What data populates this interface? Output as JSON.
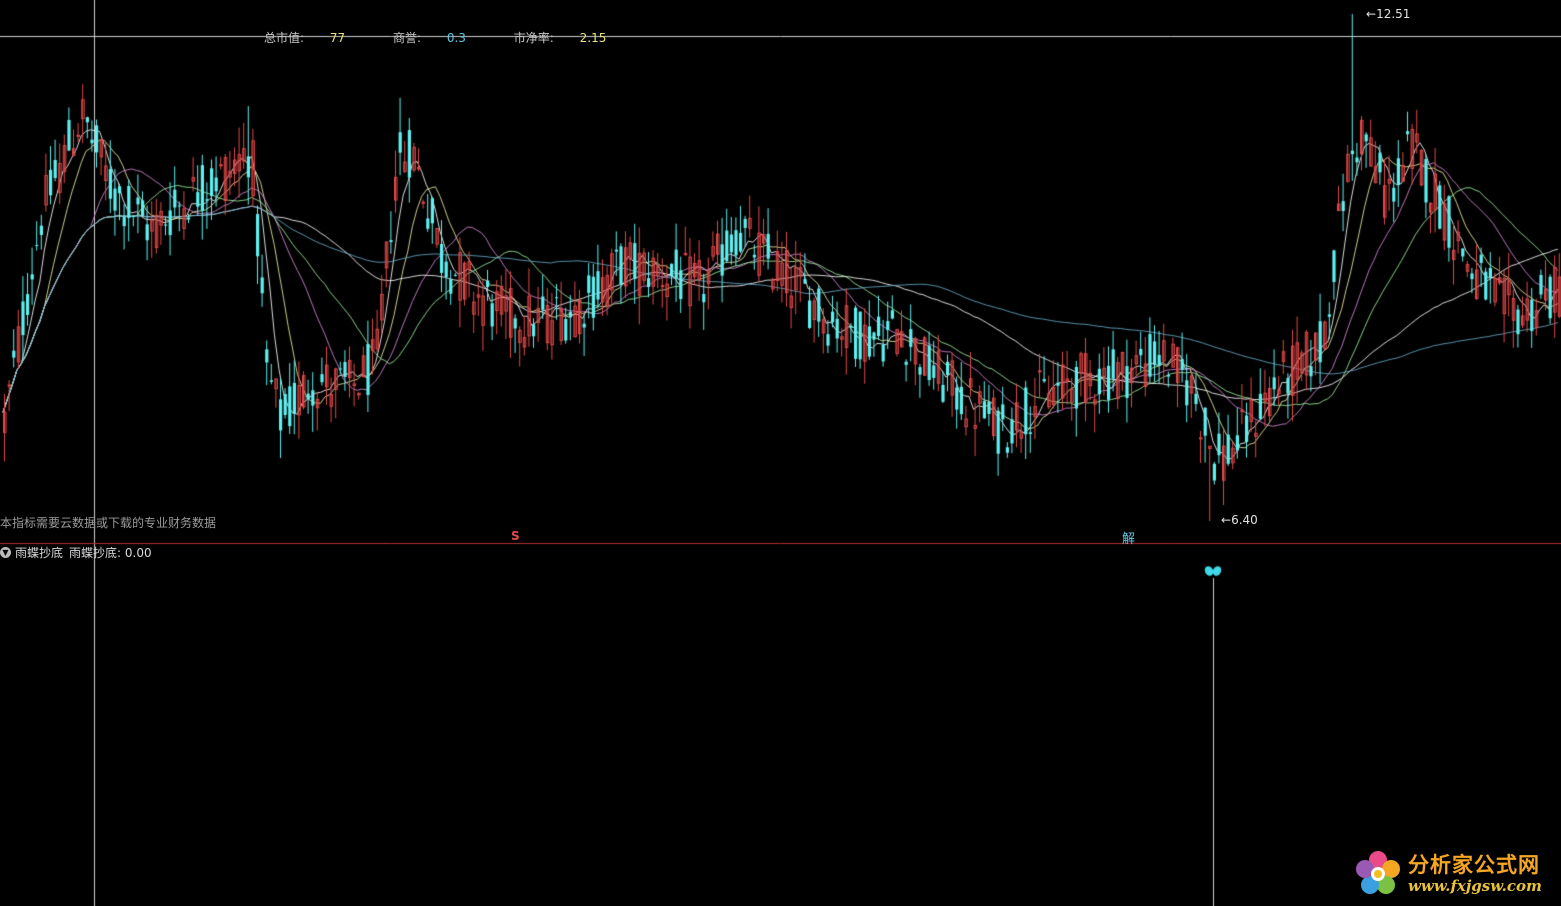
{
  "info_bar": {
    "mkt_cap_label": "总市值:",
    "mkt_cap_value": "77",
    "goodwill_label": "商誉:",
    "goodwill_value": "0.3",
    "pb_label": "市净率:",
    "pb_value": "2.15"
  },
  "note": "本指标需要云数据或下载的专业财务数据",
  "markers": {
    "s": "S",
    "jie": "解"
  },
  "sub_panel": {
    "indicator_name": "雨蝶抄底",
    "indicator_value_label": "雨蝶抄底: 0.00"
  },
  "price_labels": {
    "high": "12.51",
    "low": "6.40"
  },
  "logo": {
    "cn": "分析家公式网",
    "en": "www.fxjgsw.com"
  },
  "colors": {
    "background": "#000000",
    "up": "#e04848",
    "down": "#5ff0f0",
    "divider": "#b03030",
    "grid": "#cfcfcf",
    "ma_lines": [
      "#ffffff",
      "#f0f0a0",
      "#d88ad8",
      "#a0f0a0",
      "#ffffff",
      "#6aaac8"
    ]
  },
  "chart_data": {
    "type": "candlestick",
    "y_high": 12.51,
    "y_low": 6.4,
    "anchors_close": [
      [
        0,
        7.4
      ],
      [
        40,
        10.1
      ],
      [
        80,
        11.3
      ],
      [
        110,
        10.4
      ],
      [
        150,
        9.9
      ],
      [
        185,
        10.3
      ],
      [
        225,
        10.6
      ],
      [
        250,
        10.9
      ],
      [
        265,
        8.2
      ],
      [
        280,
        7.6
      ],
      [
        310,
        8.1
      ],
      [
        350,
        8.0
      ],
      [
        375,
        8.3
      ],
      [
        395,
        10.7
      ],
      [
        410,
        10.9
      ],
      [
        440,
        9.6
      ],
      [
        470,
        9.2
      ],
      [
        500,
        8.9
      ],
      [
        540,
        8.8
      ],
      [
        580,
        9.0
      ],
      [
        620,
        9.5
      ],
      [
        660,
        9.4
      ],
      [
        700,
        9.2
      ],
      [
        735,
        9.9
      ],
      [
        760,
        9.6
      ],
      [
        790,
        9.3
      ],
      [
        830,
        8.8
      ],
      [
        870,
        8.6
      ],
      [
        900,
        8.7
      ],
      [
        930,
        8.2
      ],
      [
        960,
        7.9
      ],
      [
        1000,
        7.5
      ],
      [
        1040,
        7.9
      ],
      [
        1080,
        8.1
      ],
      [
        1120,
        8.2
      ],
      [
        1160,
        8.4
      ],
      [
        1190,
        8.0
      ],
      [
        1215,
        7.1
      ],
      [
        1240,
        7.4
      ],
      [
        1270,
        8.0
      ],
      [
        1300,
        8.3
      ],
      [
        1320,
        8.5
      ],
      [
        1345,
        10.6
      ],
      [
        1360,
        11.1
      ],
      [
        1385,
        10.3
      ],
      [
        1410,
        10.9
      ],
      [
        1440,
        10.2
      ],
      [
        1470,
        9.4
      ],
      [
        1500,
        9.0
      ],
      [
        1520,
        8.9
      ],
      [
        1561,
        9.2
      ]
    ],
    "spikes": [
      [
        248,
        11.4
      ],
      [
        398,
        11.5
      ],
      [
        1352,
        12.51
      ],
      [
        1210,
        6.4
      ]
    ],
    "moving_average_periods": [
      5,
      10,
      20,
      30,
      60,
      120
    ]
  }
}
